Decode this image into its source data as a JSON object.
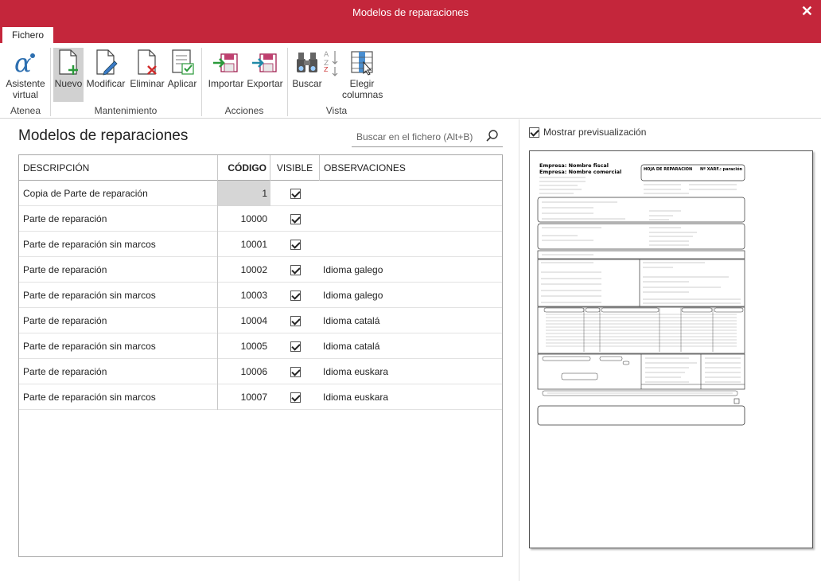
{
  "window": {
    "title": "Modelos de reparaciones",
    "close_glyph": "✕"
  },
  "ribbon": {
    "tab_file": "Fichero",
    "buttons": {
      "asistente": "Asistente virtual",
      "asistente_l1": "Asistente",
      "asistente_l2": "virtual",
      "nuevo": "Nuevo",
      "modificar": "Modificar",
      "eliminar": "Eliminar",
      "aplicar": "Aplicar",
      "importar": "Importar",
      "exportar": "Exportar",
      "buscar": "Buscar",
      "elegir_l1": "Elegir",
      "elegir_l2": "columnas"
    },
    "groups": {
      "atenea": "Atenea",
      "mantenimiento": "Mantenimiento",
      "acciones": "Acciones",
      "vista": "Vista"
    }
  },
  "main": {
    "title": "Modelos de reparaciones",
    "search_placeholder": "Buscar en el fichero (Alt+B)",
    "columns": {
      "desc": "DESCRIPCIÓN",
      "code": "CÓDIGO",
      "visible": "VISIBLE",
      "obs": "OBSERVACIONES"
    },
    "rows": [
      {
        "desc": "Copia de Parte de reparación",
        "code": "1",
        "visible": true,
        "obs": ""
      },
      {
        "desc": "Parte de reparación",
        "code": "10000",
        "visible": true,
        "obs": ""
      },
      {
        "desc": "Parte de reparación sin marcos",
        "code": "10001",
        "visible": true,
        "obs": ""
      },
      {
        "desc": "Parte de reparación",
        "code": "10002",
        "visible": true,
        "obs": "Idioma galego"
      },
      {
        "desc": "Parte de reparación sin marcos",
        "code": "10003",
        "visible": true,
        "obs": "Idioma galego"
      },
      {
        "desc": "Parte de reparación",
        "code": "10004",
        "visible": true,
        "obs": "Idioma catalá"
      },
      {
        "desc": "Parte de reparación sin marcos",
        "code": "10005",
        "visible": true,
        "obs": "Idioma catalá"
      },
      {
        "desc": "Parte de reparación",
        "code": "10006",
        "visible": true,
        "obs": "Idioma euskara"
      },
      {
        "desc": "Parte de reparación sin marcos",
        "code": "10007",
        "visible": true,
        "obs": "Idioma euskara"
      }
    ]
  },
  "preview": {
    "toggle_label": "Mostrar previsualización",
    "toggle_checked": true,
    "doc": {
      "empresa_fiscal": "Empresa: Nombre fiscal",
      "empresa_comercial": "Empresa: Nombre comercial",
      "hoja": "HOJA DE REPARACION",
      "nxarf": "Nº XARF.: paración"
    }
  },
  "colors": {
    "accent": "#c4263b"
  }
}
